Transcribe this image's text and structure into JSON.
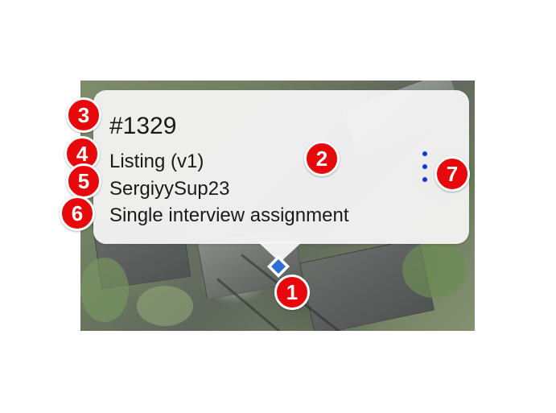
{
  "popup": {
    "title": "#1329",
    "lines": [
      "Listing (v1)",
      "SergiyySup23",
      "Single interview assignment"
    ],
    "menu_icon": "more-vertical-icon",
    "dot_color": "#1a33d9"
  },
  "marker": {
    "icon": "location-diamond-icon",
    "color": "#2a6fd6"
  },
  "badges": [
    "1",
    "2",
    "3",
    "4",
    "5",
    "6",
    "7"
  ],
  "colors": {
    "badge": "#e8070b",
    "popup_background": "#f4f4f4"
  }
}
